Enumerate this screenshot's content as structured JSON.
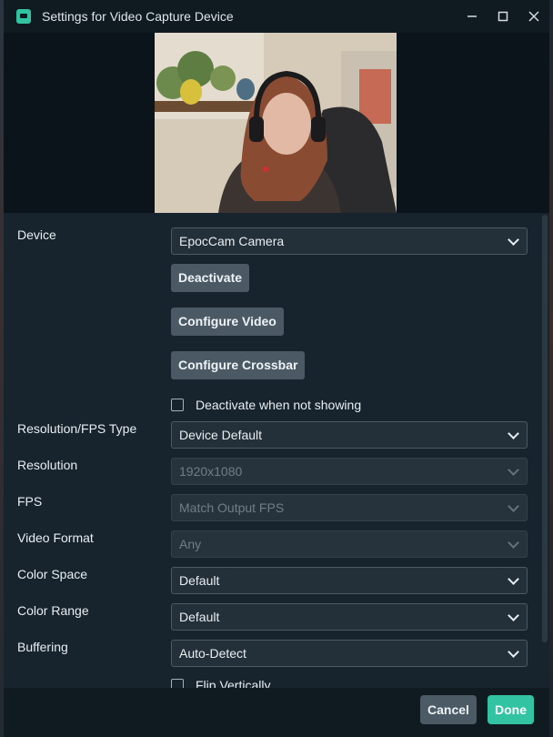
{
  "window": {
    "title": "Settings for Video Capture Device",
    "minimize_icon": "minimize-icon",
    "maximize_icon": "maximize-icon",
    "close_icon": "close-icon"
  },
  "form": {
    "device": {
      "label": "Device",
      "value": "EpocCam Camera"
    },
    "deactivate_label": "Deactivate",
    "configure_video_label": "Configure Video",
    "configure_crossbar_label": "Configure Crossbar",
    "deactivate_when_not_showing": "Deactivate when not showing",
    "resolution_fps_type": {
      "label": "Resolution/FPS Type",
      "value": "Device Default"
    },
    "resolution": {
      "label": "Resolution",
      "value": "1920x1080"
    },
    "fps": {
      "label": "FPS",
      "value": "Match Output FPS"
    },
    "video_format": {
      "label": "Video Format",
      "value": "Any"
    },
    "color_space": {
      "label": "Color Space",
      "value": "Default"
    },
    "color_range": {
      "label": "Color Range",
      "value": "Default"
    },
    "buffering": {
      "label": "Buffering",
      "value": "Auto-Detect"
    },
    "flip_vertically": "Flip Vertically"
  },
  "footer": {
    "cancel_label": "Cancel",
    "done_label": "Done"
  },
  "colors": {
    "accent": "#31c3a2",
    "window_bg": "#17242d",
    "titlebar_bg": "#0f1a21"
  }
}
